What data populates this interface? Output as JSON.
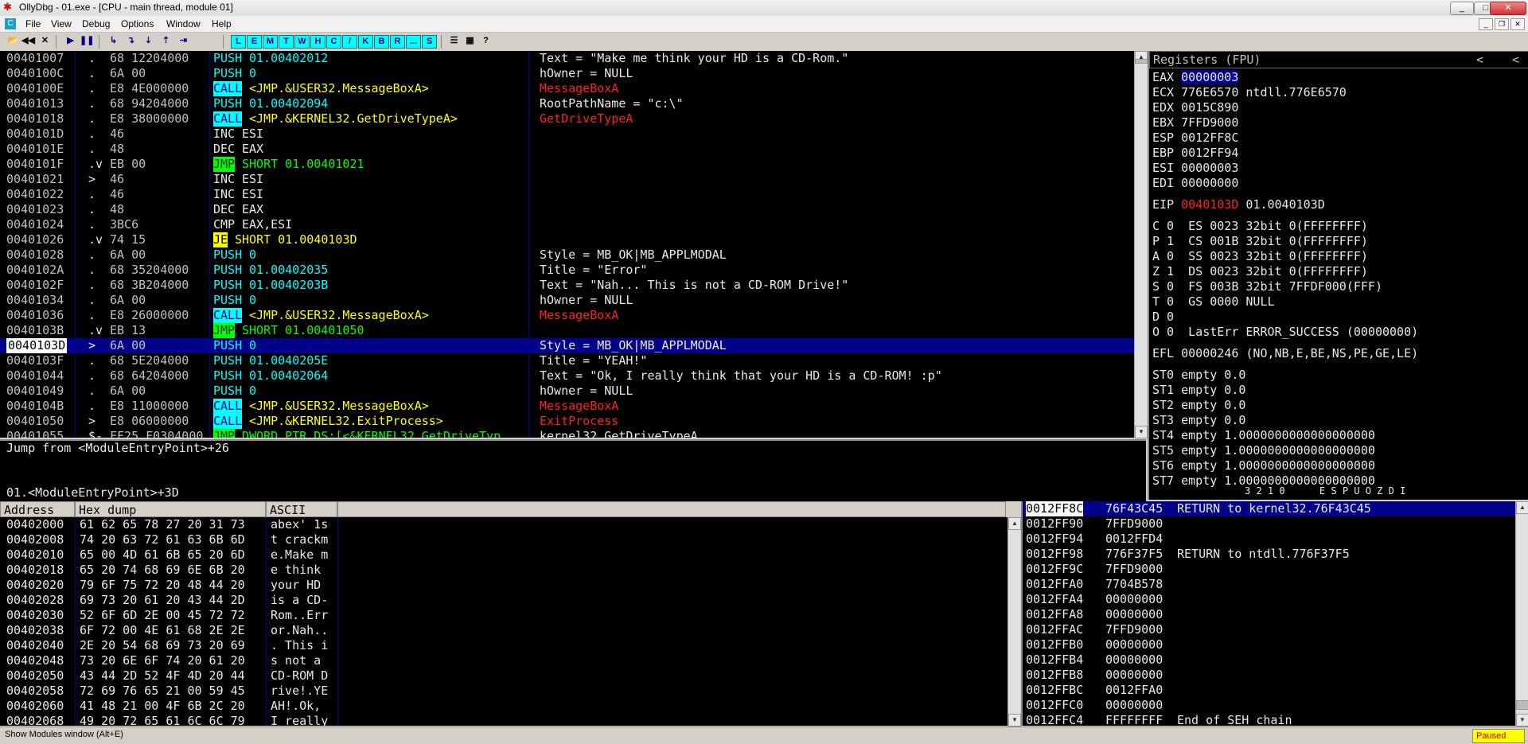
{
  "window": {
    "title": "OllyDbg - 01.exe - [CPU - main thread, module 01]",
    "controls": [
      "_",
      "□",
      "✕"
    ],
    "mdi_controls": [
      "_",
      "❐",
      "✕"
    ]
  },
  "menu": [
    "File",
    "View",
    "Debug",
    "Options",
    "Window",
    "Help"
  ],
  "toolbar": {
    "file_buttons": [
      "📂",
      "◀◀",
      "✕"
    ],
    "run_buttons": [
      "▶",
      "❚❚"
    ],
    "step_buttons": [
      "↳",
      "↴",
      "⇣",
      "⇡",
      "⇥"
    ],
    "window_letters": [
      "L",
      "E",
      "M",
      "T",
      "W",
      "H",
      "C",
      "/",
      "K",
      "B",
      "R",
      "...",
      "S"
    ],
    "extra": [
      "☰",
      "▦",
      "?"
    ]
  },
  "disasm": {
    "rows": [
      {
        "addr": "00401007",
        "mark": " .",
        "hex": "68 12204000",
        "hex_ul": "12204000",
        "kind": "push",
        "mn": "PUSH",
        "op": "01.00402012",
        "cmt": "Text = \"Make me think your HD is a CD-Rom.\"",
        "cmt_red": false
      },
      {
        "addr": "0040100C",
        "mark": " .",
        "hex": "6A 00",
        "kind": "push",
        "mn": "PUSH",
        "op": "0",
        "cmt": "hOwner = NULL",
        "cmt_red": false
      },
      {
        "addr": "0040100E",
        "mark": " .",
        "hex": "E8 4E000000",
        "kind": "call",
        "mn": "CALL",
        "op": "<JMP.&USER32.MessageBoxA>",
        "cmt": "MessageBoxA",
        "cmt_red": true
      },
      {
        "addr": "00401013",
        "mark": " .",
        "hex": "68 94204000",
        "hex_ul": "94204000",
        "kind": "push",
        "mn": "PUSH",
        "op": "01.00402094",
        "cmt": "RootPathName = \"c:\\\"",
        "cmt_red": false
      },
      {
        "addr": "00401018",
        "mark": " .",
        "hex": "E8 38000000",
        "kind": "call",
        "mn": "CALL",
        "op": "<JMP.&KERNEL32.GetDriveTypeA>",
        "cmt": "GetDriveTypeA",
        "cmt_red": true
      },
      {
        "addr": "0040101D",
        "mark": " .",
        "hex": "46",
        "kind": "plain",
        "mn": "INC",
        "op": "ESI",
        "cmt": "",
        "cmt_red": false
      },
      {
        "addr": "0040101E",
        "mark": " .",
        "hex": "48",
        "kind": "plain",
        "mn": "DEC",
        "op": "EAX",
        "cmt": "",
        "cmt_red": false
      },
      {
        "addr": "0040101F",
        "mark": " .v",
        "hex": "EB 00",
        "kind": "jmp",
        "mn": "JMP",
        "op": "SHORT 01.00401021",
        "cmt": "",
        "cmt_red": false
      },
      {
        "addr": "00401021",
        "mark": " >",
        "hex": "46",
        "kind": "plain",
        "mn": "INC",
        "op": "ESI",
        "cmt": "",
        "cmt_red": false
      },
      {
        "addr": "00401022",
        "mark": " .",
        "hex": "46",
        "kind": "plain",
        "mn": "INC",
        "op": "ESI",
        "cmt": "",
        "cmt_red": false
      },
      {
        "addr": "00401023",
        "mark": " .",
        "hex": "48",
        "kind": "plain",
        "mn": "DEC",
        "op": "EAX",
        "cmt": "",
        "cmt_red": false
      },
      {
        "addr": "00401024",
        "mark": " .",
        "hex": "3BC6",
        "kind": "plain",
        "mn": "CMP",
        "op": "EAX,ESI",
        "cmt": "",
        "cmt_red": false
      },
      {
        "addr": "00401026",
        "mark": " .v",
        "hex": "74 15",
        "kind": "je",
        "mn": "JE",
        "op": "SHORT 01.0040103D",
        "cmt": "",
        "cmt_red": false
      },
      {
        "addr": "00401028",
        "mark": " .",
        "hex": "6A 00",
        "kind": "push",
        "mn": "PUSH",
        "op": "0",
        "cmt": "Style = MB_OK|MB_APPLMODAL",
        "cmt_red": false
      },
      {
        "addr": "0040102A",
        "mark": " .",
        "hex": "68 35204000",
        "hex_ul": "35204000",
        "kind": "push",
        "mn": "PUSH",
        "op": "01.00402035",
        "cmt": "Title = \"Error\"",
        "cmt_red": false
      },
      {
        "addr": "0040102F",
        "mark": " .",
        "hex": "68 3B204000",
        "hex_ul": "3B204000",
        "kind": "push",
        "mn": "PUSH",
        "op": "01.0040203B",
        "cmt": "Text = \"Nah... This is not a CD-ROM Drive!\"",
        "cmt_red": false
      },
      {
        "addr": "00401034",
        "mark": " .",
        "hex": "6A 00",
        "kind": "push",
        "mn": "PUSH",
        "op": "0",
        "cmt": "hOwner = NULL",
        "cmt_red": false
      },
      {
        "addr": "00401036",
        "mark": " .",
        "hex": "E8 26000000",
        "kind": "call",
        "mn": "CALL",
        "op": "<JMP.&USER32.MessageBoxA>",
        "cmt": "MessageBoxA",
        "cmt_red": true
      },
      {
        "addr": "0040103B",
        "mark": " .v",
        "hex": "EB 13",
        "kind": "jmp",
        "mn": "JMP",
        "op": "SHORT 01.00401050",
        "cmt": "",
        "cmt_red": false
      },
      {
        "addr": "0040103D",
        "mark": " >",
        "hex": "6A 00",
        "kind": "push",
        "mn": "PUSH",
        "op": "0",
        "cmt": "Style = MB_OK|MB_APPLMODAL",
        "cmt_red": false,
        "selected": true
      },
      {
        "addr": "0040103F",
        "mark": " .",
        "hex": "68 5E204000",
        "hex_ul": "5E204000",
        "kind": "push",
        "mn": "PUSH",
        "op": "01.0040205E",
        "cmt": "Title = \"YEAH!\"",
        "cmt_red": false
      },
      {
        "addr": "00401044",
        "mark": " .",
        "hex": "68 64204000",
        "hex_ul": "64204000",
        "kind": "push",
        "mn": "PUSH",
        "op": "01.00402064",
        "cmt": "Text = \"Ok, I really think that your HD is a CD-ROM! :p\"",
        "cmt_red": false
      },
      {
        "addr": "00401049",
        "mark": " .",
        "hex": "6A 00",
        "kind": "push",
        "mn": "PUSH",
        "op": "0",
        "cmt": "hOwner = NULL",
        "cmt_red": false
      },
      {
        "addr": "0040104B",
        "mark": " .",
        "hex": "E8 11000000",
        "kind": "call",
        "mn": "CALL",
        "op": "<JMP.&USER32.MessageBoxA>",
        "cmt": "MessageBoxA",
        "cmt_red": true
      },
      {
        "addr": "00401050",
        "mark": " >",
        "hex": "E8 06000000",
        "kind": "call",
        "mn": "CALL",
        "op": "<JMP.&KERNEL32.ExitProcess>",
        "cmt": "ExitProcess",
        "cmt_red": true
      },
      {
        "addr": "00401055",
        "mark": " $-",
        "hex": "FF25 F0304000",
        "kind": "jmp",
        "mn": "JMP",
        "op": "DWORD PTR DS:[<&KERNEL32.GetDriveTyp",
        "cmt": "kernel32.GetDriveTypeA",
        "cmt_red": false
      }
    ]
  },
  "info": {
    "line1": "Jump from <ModuleEntryPoint>+26",
    "line2": "01.<ModuleEntryPoint>+3D"
  },
  "registers": {
    "header": "Registers (FPU)",
    "nav": [
      "<",
      "<"
    ],
    "gp": [
      {
        "name": "EAX",
        "val": "00000003",
        "extra": "",
        "val_hl": true
      },
      {
        "name": "ECX",
        "val": "776E6570",
        "extra": "ntdll.776E6570"
      },
      {
        "name": "EDX",
        "val": "0015C890",
        "extra": ""
      },
      {
        "name": "EBX",
        "val": "7FFD9000",
        "extra": ""
      },
      {
        "name": "ESP",
        "val": "0012FF8C",
        "extra": ""
      },
      {
        "name": "EBP",
        "val": "0012FF94",
        "extra": ""
      },
      {
        "name": "ESI",
        "val": "00000003",
        "extra": ""
      },
      {
        "name": "EDI",
        "val": "00000000",
        "extra": ""
      }
    ],
    "eip": {
      "name": "EIP",
      "val": "0040103D",
      "extra": "01.0040103D"
    },
    "flags": [
      "C 0  ES 0023 32bit 0(FFFFFFFF)",
      "P 1  CS 001B 32bit 0(FFFFFFFF)",
      "A 0  SS 0023 32bit 0(FFFFFFFF)",
      "Z 1  DS 0023 32bit 0(FFFFFFFF)",
      "S 0  FS 003B 32bit 7FFDF000(FFF)",
      "T 0  GS 0000 NULL",
      "D 0",
      "O 0  LastErr ERROR_SUCCESS (00000000)"
    ],
    "efl": "EFL 00000246 (NO,NB,E,BE,NS,PE,GE,LE)",
    "fpu": [
      "ST0 empty 0.0",
      "ST1 empty 0.0",
      "ST2 empty 0.0",
      "ST3 empty 0.0",
      "ST4 empty 1.0000000000000000000",
      "ST5 empty 1.0000000000000000000",
      "ST6 empty 1.0000000000000000000",
      "ST7 empty 1.0000000000000000000"
    ],
    "fpu_tail": "3 2 1 0      E S P U O Z D I"
  },
  "dump": {
    "headers": {
      "address": "Address",
      "hex": "Hex dump",
      "ascii": "ASCII"
    },
    "rows": [
      {
        "addr": "00402000",
        "hex": "61 62 65 78 27 20 31 73",
        "ascii": "abex' 1s"
      },
      {
        "addr": "00402008",
        "hex": "74 20 63 72 61 63 6B 6D",
        "ascii": "t crackm"
      },
      {
        "addr": "00402010",
        "hex": "65 00 4D 61 6B 65 20 6D",
        "ascii": "e.Make m"
      },
      {
        "addr": "00402018",
        "hex": "65 20 74 68 69 6E 6B 20",
        "ascii": "e think "
      },
      {
        "addr": "00402020",
        "hex": "79 6F 75 72 20 48 44 20",
        "ascii": "your HD "
      },
      {
        "addr": "00402028",
        "hex": "69 73 20 61 20 43 44 2D",
        "ascii": "is a CD-"
      },
      {
        "addr": "00402030",
        "hex": "52 6F 6D 2E 00 45 72 72",
        "ascii": "Rom..Err"
      },
      {
        "addr": "00402038",
        "hex": "6F 72 00 4E 61 68 2E 2E",
        "ascii": "or.Nah.."
      },
      {
        "addr": "00402040",
        "hex": "2E 20 54 68 69 73 20 69",
        "ascii": ". This i"
      },
      {
        "addr": "00402048",
        "hex": "73 20 6E 6F 74 20 61 20",
        "ascii": "s not a "
      },
      {
        "addr": "00402050",
        "hex": "43 44 2D 52 4F 4D 20 44",
        "ascii": "CD-ROM D"
      },
      {
        "addr": "00402058",
        "hex": "72 69 76 65 21 00 59 45",
        "ascii": "rive!.YE"
      },
      {
        "addr": "00402060",
        "hex": "41 48 21 00 4F 6B 2C 20",
        "ascii": "AH!.Ok, "
      },
      {
        "addr": "00402068",
        "hex": "49 20 72 65 61 6C 6C 79",
        "ascii": "I really"
      }
    ]
  },
  "stack": {
    "rows": [
      {
        "addr": "0012FF8C",
        "val": "76F43C45",
        "cmt": "RETURN to kernel32.76F43C45",
        "selected": true
      },
      {
        "addr": "0012FF90",
        "val": "7FFD9000",
        "cmt": ""
      },
      {
        "addr": "0012FF94",
        "val": "0012FFD4",
        "cmt": "",
        "bracket": true
      },
      {
        "addr": "0012FF98",
        "val": "776F37F5",
        "cmt": "RETURN to ntdll.776F37F5"
      },
      {
        "addr": "0012FF9C",
        "val": "7FFD9000",
        "cmt": ""
      },
      {
        "addr": "0012FFA0",
        "val": "7704B578",
        "cmt": ""
      },
      {
        "addr": "0012FFA4",
        "val": "00000000",
        "cmt": ""
      },
      {
        "addr": "0012FFA8",
        "val": "00000000",
        "cmt": ""
      },
      {
        "addr": "0012FFAC",
        "val": "7FFD9000",
        "cmt": ""
      },
      {
        "addr": "0012FFB0",
        "val": "00000000",
        "cmt": ""
      },
      {
        "addr": "0012FFB4",
        "val": "00000000",
        "cmt": ""
      },
      {
        "addr": "0012FFB8",
        "val": "00000000",
        "cmt": ""
      },
      {
        "addr": "0012FFBC",
        "val": "0012FFA0",
        "cmt": ""
      },
      {
        "addr": "0012FFC0",
        "val": "00000000",
        "cmt": ""
      },
      {
        "addr": "0012FFC4",
        "val": "FFFFFFFF",
        "cmt": "End of SEH chain"
      }
    ]
  },
  "status": {
    "text": "Show Modules window (Alt+E)",
    "state": "Paused"
  },
  "colors": {
    "pane_bg": "#000000",
    "selection": "#00008b",
    "mnemonic_call_bg": "#00ffff",
    "mnemonic_jmp_bg": "#00ff00",
    "mnemonic_je_bg": "#ffff00",
    "api_comment": "#ff2020",
    "status_paused_bg": "#ffff00"
  }
}
